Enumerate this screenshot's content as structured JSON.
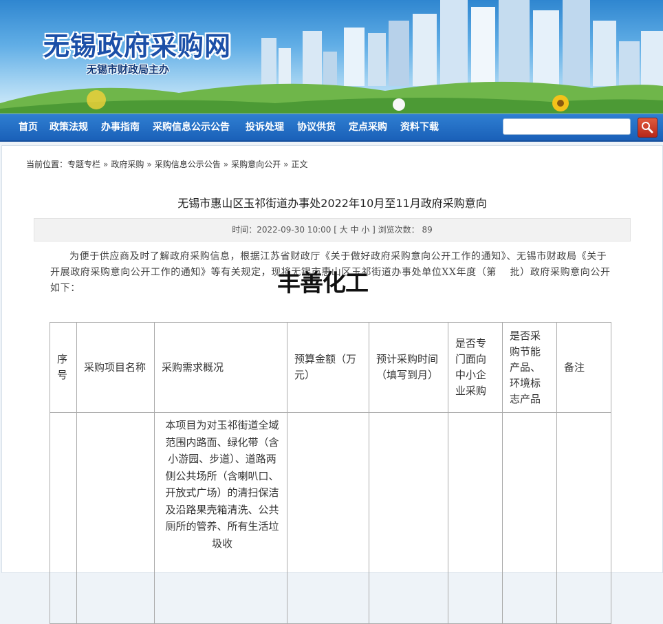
{
  "banner": {
    "title": "无锡政府采购网",
    "subtitle": "无锡市财政局主办"
  },
  "nav": {
    "items": [
      "首页",
      "政策法规",
      "办事指南",
      "采购信息公示公告",
      "投诉处理",
      "协议供货",
      "定点采购",
      "资料下载"
    ],
    "search_placeholder": "",
    "search_icon": "search-icon"
  },
  "breadcrumb": {
    "prefix": "当前位置：",
    "items": [
      "专题专栏",
      "政府采购",
      "采购信息公示公告",
      "采购意向公开",
      "正文"
    ],
    "separator": "»"
  },
  "article": {
    "title": "无锡市惠山区玉祁街道办事处2022年10月至11月政府采购意向",
    "meta": "时间：2022-09-30 10:00 [ 大 中 小 ] 浏览次数： 89",
    "intro": "为便于供应商及时了解政府采购信息，根据江苏省财政厅《关于做好政府采购意向公开工作的通知》、无锡市财政局《关于开展政府采购意向公开工作的通知》等有关规定，现将无锡市惠山区玉祁街道办事处单位XX年度（第　 批）政府采购意向公开如下：",
    "watermark": "丰善化工"
  },
  "table": {
    "headers": [
      "序号",
      "采购项目名称",
      "采购需求概况",
      "预算金额（万元）",
      "预计采购时间（填写到月）",
      "是否专门面向中小企业采购",
      "是否采购节能产品、环境标志产品",
      "备注"
    ],
    "rows": [
      [
        "",
        "",
        "本项目为对玉祁街道全域范围内路面、绿化带（含小游园、步道）、道路两侧公共场所（含喇叭口、开放式广场）的清扫保洁及沿路果壳箱清洗、公共厕所的管养、所有生活垃圾收",
        "",
        "",
        "",
        "",
        ""
      ]
    ]
  }
}
